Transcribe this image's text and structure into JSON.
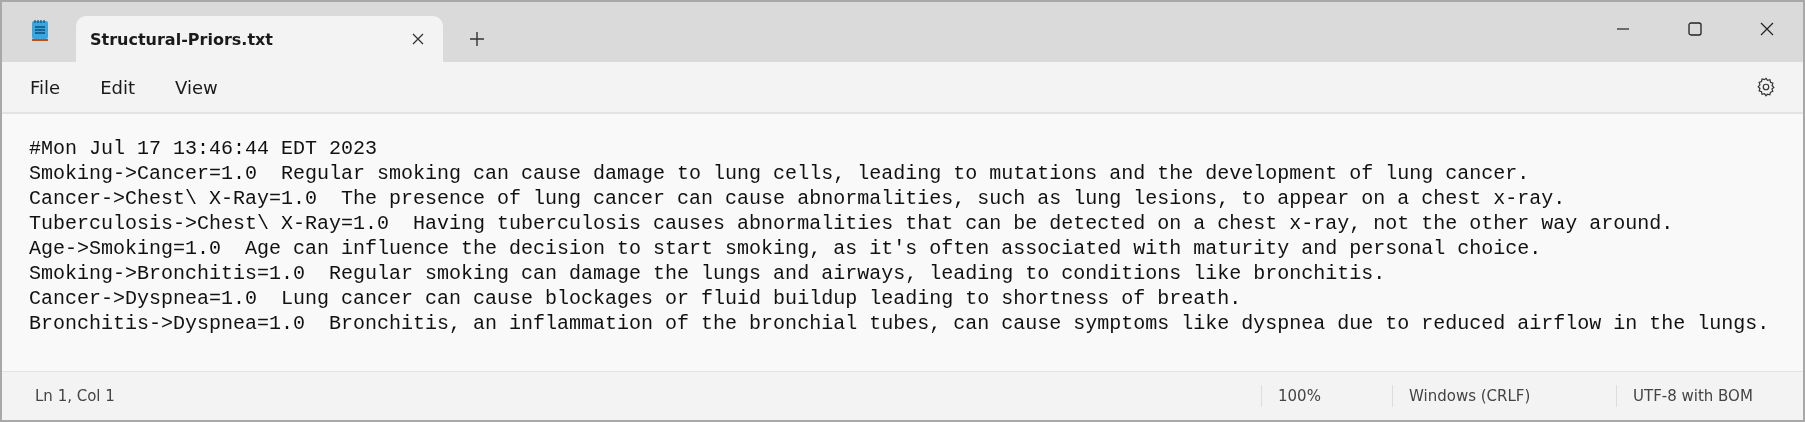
{
  "tabs": [
    {
      "label": "Structural-Priors.txt",
      "selected": true
    }
  ],
  "menu": [
    "File",
    "Edit",
    "View"
  ],
  "editor": {
    "lines": [
      "#Mon Jul 17 13:46:44 EDT 2023",
      "Smoking->Cancer=1.0  Regular smoking can cause damage to lung cells, leading to mutations and the development of lung cancer.",
      "Cancer->Chest\\ X-Ray=1.0  The presence of lung cancer can cause abnormalities, such as lung lesions, to appear on a chest x-ray.",
      "Tuberculosis->Chest\\ X-Ray=1.0  Having tuberculosis causes abnormalities that can be detected on a chest x-ray, not the other way around.",
      "Age->Smoking=1.0  Age can influence the decision to start smoking, as it's often associated with maturity and personal choice.",
      "Smoking->Bronchitis=1.0  Regular smoking can damage the lungs and airways, leading to conditions like bronchitis.",
      "Cancer->Dyspnea=1.0  Lung cancer can cause blockages or fluid buildup leading to shortness of breath.",
      "Bronchitis->Dyspnea=1.0  Bronchitis, an inflammation of the bronchial tubes, can cause symptoms like dyspnea due to reduced airflow in the lungs."
    ]
  },
  "status_bar": {
    "position": "Ln 1, Col 1",
    "zoom": "100%",
    "line_ending": "Windows (CRLF)",
    "encoding": "UTF-8 with BOM"
  }
}
